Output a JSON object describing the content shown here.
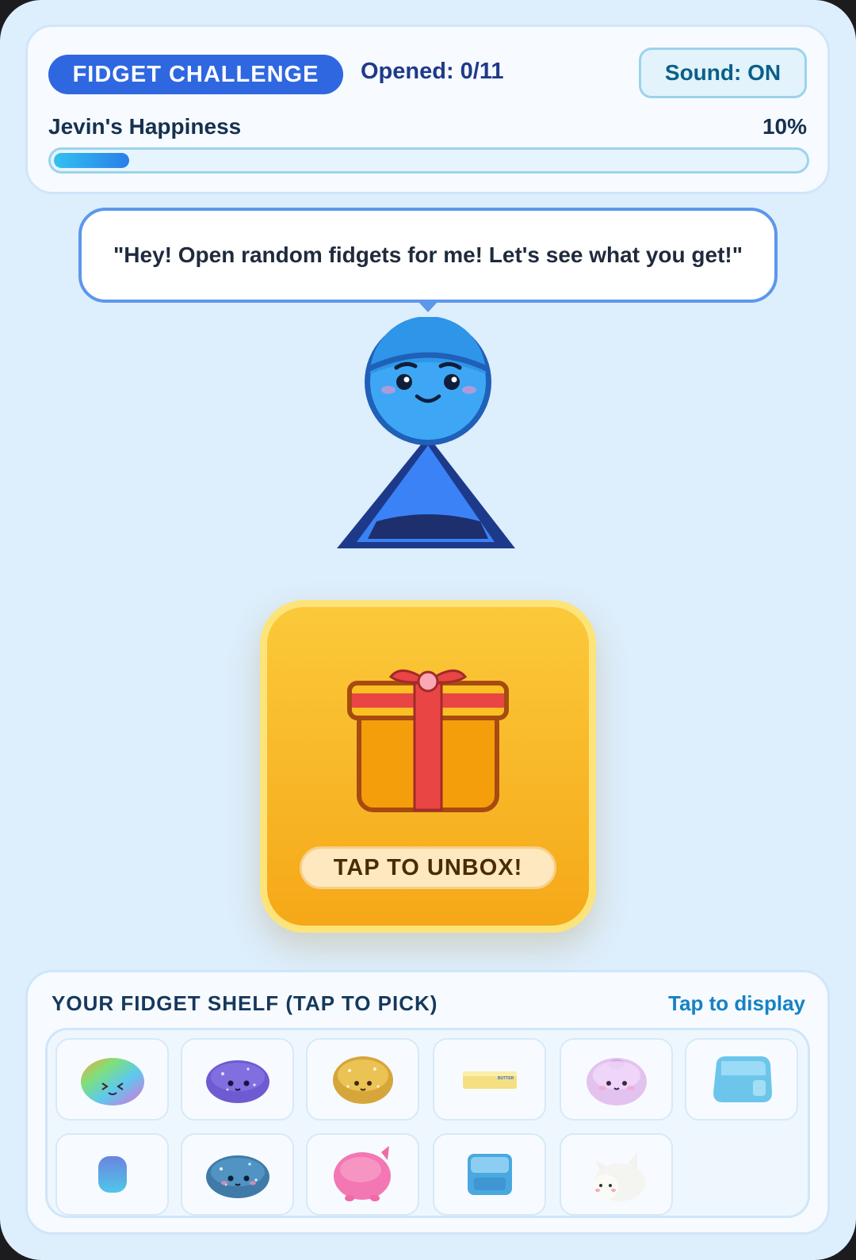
{
  "header": {
    "badge": "FIDGET CHALLENGE",
    "opened": "Opened: 0/11",
    "sound_button": "Sound: ON",
    "happiness_label": "Jevin's Happiness",
    "happiness_percent_text": "10%",
    "happiness_fraction": 0.1
  },
  "speech": {
    "text": "\"Hey! Open random fidgets for me! Let's see what you get!\""
  },
  "unbox": {
    "button": "TAP TO UNBOX!"
  },
  "shelf": {
    "title": "YOUR FIDGET SHELF (TAP TO PICK)",
    "hint": "Tap to display",
    "items": [
      {
        "name": "rainbow-squishy-icon"
      },
      {
        "name": "purple-glitter-squishy-icon"
      },
      {
        "name": "gold-glitter-squishy-icon"
      },
      {
        "name": "butter-stick-squishy-icon",
        "label": "BUTTER"
      },
      {
        "name": "lavender-bun-squishy-icon"
      },
      {
        "name": "blue-ice-cube-squishy-icon"
      },
      {
        "name": "blue-capsule-squishy-icon"
      },
      {
        "name": "blue-glitter-squishy-icon"
      },
      {
        "name": "pink-pig-squishy-icon"
      },
      {
        "name": "blue-cube-squishy-icon"
      },
      {
        "name": "white-cat-squishy-icon"
      }
    ]
  },
  "colors": {
    "background": "#ddeefc",
    "badge": "#2f67e0",
    "unbox_gold": "#fbc93a",
    "character_blue": "#3b9cf0",
    "ribbon_red": "#e94545"
  }
}
